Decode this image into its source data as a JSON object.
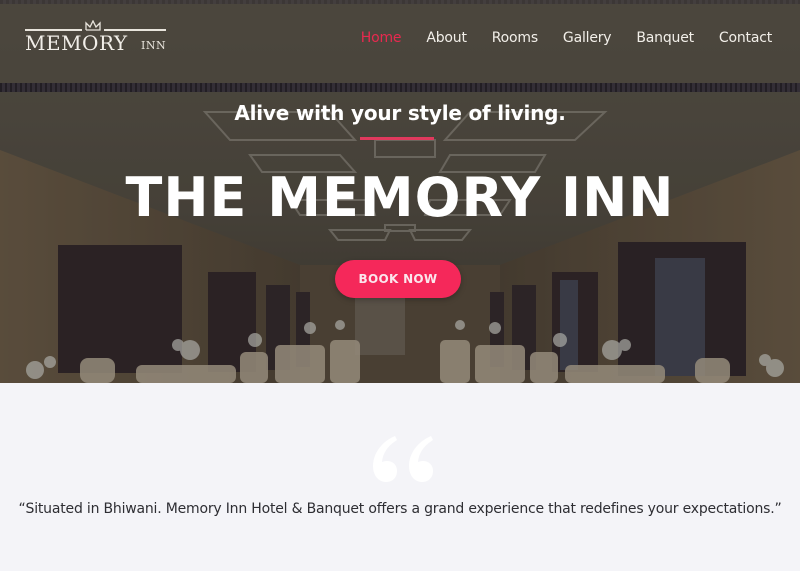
{
  "brand": {
    "logo_main": "MEMORY",
    "logo_sub": "INN"
  },
  "nav": {
    "items": [
      {
        "label": "Home",
        "active": true
      },
      {
        "label": "About",
        "active": false
      },
      {
        "label": "Rooms",
        "active": false
      },
      {
        "label": "Gallery",
        "active": false
      },
      {
        "label": "Banquet",
        "active": false
      },
      {
        "label": "Contact",
        "active": false
      }
    ]
  },
  "hero": {
    "tagline": "Alive with your style of living.",
    "title": "THE MEMORY INN",
    "cta_label": "BOOK NOW",
    "background": "banquet-hall-photo"
  },
  "quote": {
    "icon": "quote-open-icon",
    "text": "“Situated in Bhiwani. Memory Inn Hotel & Banquet offers a grand experience that redefines your expectations.”"
  },
  "colors": {
    "accent": "#f5285a",
    "active_nav": "#e8294f",
    "section_bg": "#f4f4f8",
    "text_dark": "#2e2e33"
  }
}
